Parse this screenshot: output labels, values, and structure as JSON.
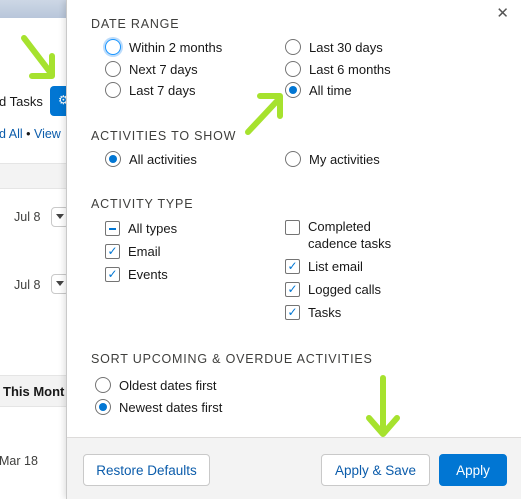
{
  "background": {
    "tasks_label": "d Tasks",
    "links": {
      "all_label": "d All",
      "separator": " • ",
      "view_label": "View"
    },
    "rows": [
      {
        "date": "Jul 8"
      },
      {
        "date": "Jul 8"
      }
    ],
    "month_header": "This Mont",
    "last_date": "Mar 18",
    "gear_icon": "gear-icon"
  },
  "filters": {
    "close_icon": "✕",
    "date_range": {
      "title": "DATE RANGE",
      "options": [
        {
          "label": "Within 2 months",
          "checked": false,
          "focused": true
        },
        {
          "label": "Next 7 days",
          "checked": false
        },
        {
          "label": "Last 7 days",
          "checked": false
        },
        {
          "label": "Last 30 days",
          "checked": false
        },
        {
          "label": "Last 6 months",
          "checked": false
        },
        {
          "label": "All time",
          "checked": true
        }
      ]
    },
    "activities_to_show": {
      "title": "ACTIVITIES TO SHOW",
      "options": [
        {
          "label": "All activities",
          "checked": true
        },
        {
          "label": "My activities",
          "checked": false
        }
      ]
    },
    "activity_type": {
      "title": "ACTIVITY TYPE",
      "options": [
        {
          "label": "All types",
          "state": "indeterminate"
        },
        {
          "label": "Email",
          "state": "checked"
        },
        {
          "label": "Events",
          "state": "checked"
        },
        {
          "label": "Completed cadence tasks",
          "state": "unchecked"
        },
        {
          "label": "List email",
          "state": "checked"
        },
        {
          "label": "Logged calls",
          "state": "checked"
        },
        {
          "label": "Tasks",
          "state": "checked"
        }
      ]
    },
    "sort": {
      "title": "SORT UPCOMING & OVERDUE ACTIVITIES",
      "options": [
        {
          "label": "Oldest dates first",
          "checked": false
        },
        {
          "label": "Newest dates first",
          "checked": true
        }
      ]
    },
    "footer": {
      "restore_label": "Restore Defaults",
      "apply_save_label": "Apply & Save",
      "apply_label": "Apply"
    }
  },
  "colors": {
    "brand": "#0176d3",
    "annotation_arrow": "#a6e22e"
  }
}
